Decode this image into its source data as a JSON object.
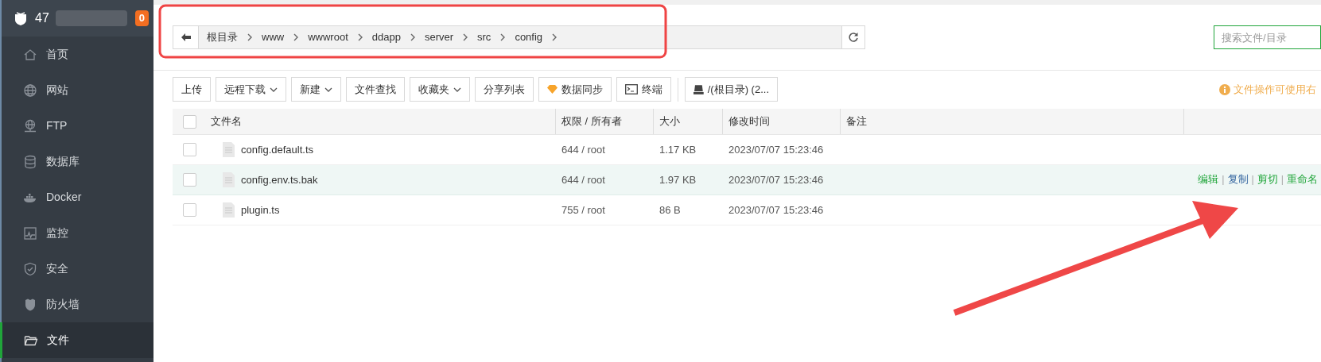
{
  "sidebar": {
    "server": {
      "label": "47",
      "badge": "0"
    },
    "items": [
      {
        "label": "首页",
        "selected": false
      },
      {
        "label": "网站",
        "selected": false
      },
      {
        "label": "FTP",
        "selected": false
      },
      {
        "label": "数据库",
        "selected": false
      },
      {
        "label": "Docker",
        "selected": false
      },
      {
        "label": "监控",
        "selected": false
      },
      {
        "label": "安全",
        "selected": false
      },
      {
        "label": "防火墙",
        "selected": false
      },
      {
        "label": "文件",
        "selected": true
      }
    ]
  },
  "path_bar": {
    "segments": [
      "根目录",
      "www",
      "wwwroot",
      "ddapp",
      "server",
      "src",
      "config"
    ]
  },
  "search": {
    "placeholder": "搜索文件/目录"
  },
  "toolbar": [
    {
      "label": "上传",
      "kind": "plain"
    },
    {
      "label": "远程下载",
      "kind": "dropdown"
    },
    {
      "label": "新建",
      "kind": "dropdown"
    },
    {
      "label": "文件查找",
      "kind": "plain"
    },
    {
      "label": "收藏夹",
      "kind": "dropdown"
    },
    {
      "label": "分享列表",
      "kind": "plain"
    },
    {
      "label": "数据同步",
      "kind": "sync"
    },
    {
      "label": "终端",
      "kind": "terminal"
    },
    {
      "label": "/(根目录) (2...",
      "kind": "disk"
    }
  ],
  "notice": "文件操作可使用右",
  "table": {
    "all_checked": false,
    "columns": [
      "文件名",
      "权限 / 所有者",
      "大小",
      "修改时间",
      "备注"
    ],
    "rows": [
      {
        "name": "config.default.ts",
        "perm": "644 / root",
        "size": "1.17 KB",
        "mtime": "2023/07/07 15:23:46",
        "checked": false,
        "hovered": false,
        "actions": []
      },
      {
        "name": "config.env.ts.bak",
        "perm": "644 / root",
        "size": "1.97 KB",
        "mtime": "2023/07/07 15:23:46",
        "checked": false,
        "hovered": true,
        "actions": [
          {
            "kind": "link",
            "label": "编辑",
            "hovered": false
          },
          {
            "kind": "separator",
            "label": "|"
          },
          {
            "kind": "link",
            "label": "复制",
            "hovered": true
          },
          {
            "kind": "separator",
            "label": "|"
          },
          {
            "kind": "link",
            "label": "剪切",
            "hovered": false
          },
          {
            "kind": "separator",
            "label": "|"
          },
          {
            "kind": "link",
            "label": "重命名",
            "hovered": false
          }
        ]
      },
      {
        "name": "plugin.ts",
        "perm": "755 / root",
        "size": "86 B",
        "mtime": "2023/07/07 15:23:46",
        "checked": false,
        "hovered": false,
        "actions": []
      }
    ]
  },
  "annotations": {
    "highlight_box": true,
    "arrow": true
  }
}
